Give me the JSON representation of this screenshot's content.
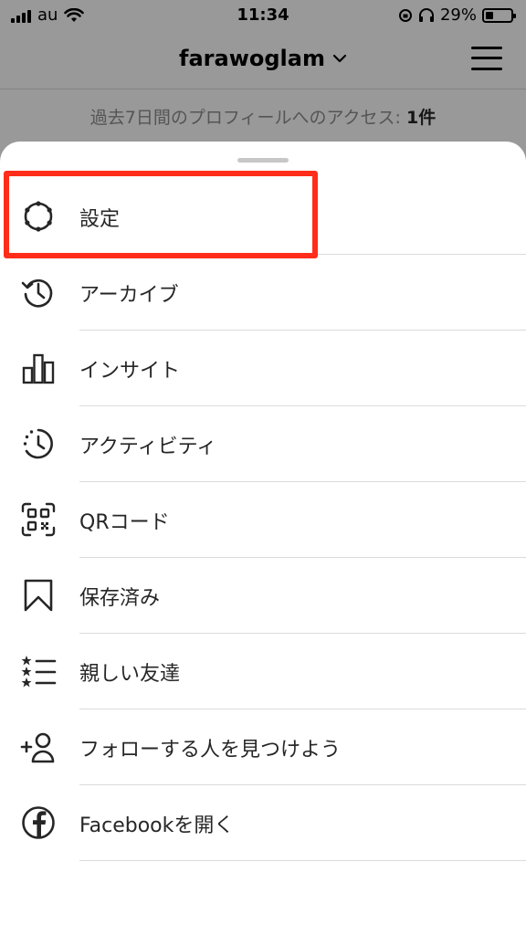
{
  "status_bar": {
    "carrier": "au",
    "time": "11:34",
    "battery_percent": "29%",
    "battery_level": 0.29
  },
  "header": {
    "username": "farawoglam",
    "access_text": "過去7日間のプロフィールへのアクセス: ",
    "access_count": "1件"
  },
  "menu": {
    "items": [
      {
        "label": "設定",
        "icon": "gear-icon"
      },
      {
        "label": "アーカイブ",
        "icon": "archive-history-icon"
      },
      {
        "label": "インサイト",
        "icon": "insights-bar-chart-icon"
      },
      {
        "label": "アクティビティ",
        "icon": "activity-clock-icon"
      },
      {
        "label": "QRコード",
        "icon": "qr-code-icon"
      },
      {
        "label": "保存済み",
        "icon": "bookmark-icon"
      },
      {
        "label": "親しい友達",
        "icon": "close-friends-list-icon"
      },
      {
        "label": "フォローする人を見つけよう",
        "icon": "add-person-icon"
      },
      {
        "label": "Facebookを開く",
        "icon": "facebook-icon"
      }
    ]
  },
  "colors": {
    "highlight": "#ff2d1a",
    "divider": "#dbdbdb",
    "text": "#262626"
  }
}
